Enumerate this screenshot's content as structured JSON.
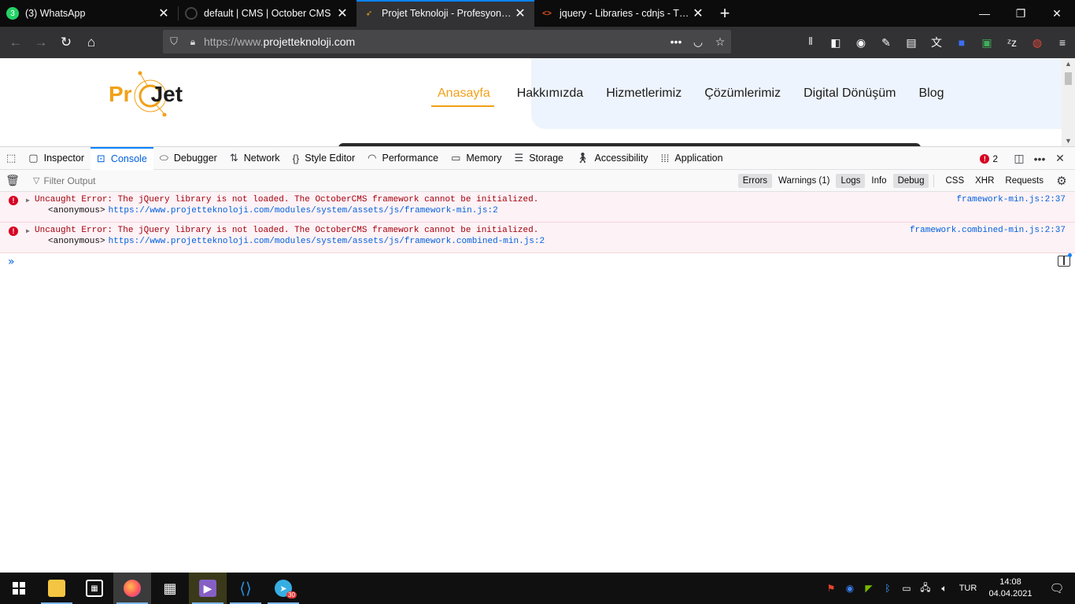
{
  "browser": {
    "tabs": [
      {
        "title": "(3) WhatsApp",
        "badge": "3",
        "favicon": "whatsapp-icon",
        "color": "#25d366"
      },
      {
        "title": "default | CMS | October CMS",
        "favicon": "github-icon",
        "color": "#444444"
      },
      {
        "title": "Projet Teknoloji - Profesyonel, I",
        "favicon": "projet-icon",
        "color": "#f1a017",
        "active": true
      },
      {
        "title": "jquery - Libraries - cdnjs - The #",
        "favicon": "code-icon",
        "color": "#e95420"
      }
    ],
    "url_scheme": "https://www.",
    "url_host": "projetteknoloji.com"
  },
  "website": {
    "logo": {
      "pr": "Pr",
      "o": "O",
      "jet": "Jet"
    },
    "nav": [
      "Anasayfa",
      "Hakkımızda",
      "Hizmetlerimiz",
      "Çözümlerimiz",
      "Digital Dönüşüm",
      "Blog"
    ],
    "nav_active": "Anasayfa"
  },
  "devtools": {
    "tabs": [
      {
        "label": "Inspector",
        "icon": "inspector-icon"
      },
      {
        "label": "Console",
        "icon": "console-icon",
        "active": true
      },
      {
        "label": "Debugger",
        "icon": "debugger-icon"
      },
      {
        "label": "Network",
        "icon": "network-icon"
      },
      {
        "label": "Style Editor",
        "icon": "style-editor-icon"
      },
      {
        "label": "Performance",
        "icon": "performance-icon"
      },
      {
        "label": "Memory",
        "icon": "memory-icon"
      },
      {
        "label": "Storage",
        "icon": "storage-icon"
      },
      {
        "label": "Accessibility",
        "icon": "accessibility-icon"
      },
      {
        "label": "Application",
        "icon": "application-icon"
      }
    ],
    "error_count": "2",
    "filter_placeholder": "Filter Output",
    "filters": [
      {
        "label": "Errors",
        "on": true
      },
      {
        "label": "Warnings (1)",
        "on": false
      },
      {
        "label": "Logs",
        "on": true
      },
      {
        "label": "Info",
        "on": false
      },
      {
        "label": "Debug",
        "on": true
      }
    ],
    "net_filters": [
      "CSS",
      "XHR",
      "Requests"
    ],
    "messages": [
      {
        "text": "Uncaught Error: The jQuery library is not loaded. The OctoberCMS framework cannot be initialized.",
        "frame_fn": "<anonymous>",
        "frame_url": "https://www.projetteknoloji.com/modules/system/assets/js/framework-min.js:2",
        "source": "framework-min.js:2:37"
      },
      {
        "text": "Uncaught Error: The jQuery library is not loaded. The OctoberCMS framework cannot be initialized.",
        "frame_fn": "<anonymous>",
        "frame_url": "https://www.projetteknoloji.com/modules/system/assets/js/framework.combined-min.js:2",
        "source": "framework.combined-min.js:2:37"
      }
    ]
  },
  "taskbar": {
    "apps": [
      {
        "name": "file-explorer-icon",
        "glyph": "▆",
        "color": "#f4c542"
      },
      {
        "name": "store-icon",
        "glyph": "🛍",
        "color": "#ffffff"
      },
      {
        "name": "firefox-icon",
        "glyph": "●",
        "color": "#ff7139",
        "active": true
      },
      {
        "name": "calculator-icon",
        "glyph": "▦",
        "color": "#ffffff"
      },
      {
        "name": "visual-studio-icon",
        "glyph": "◣",
        "color": "#865fc5"
      },
      {
        "name": "vscode-icon",
        "glyph": "◆",
        "color": "#2c8fdd"
      },
      {
        "name": "telegram-icon",
        "glyph": "➤",
        "color": "#37aee2",
        "badge": "30"
      }
    ],
    "lang": "TUR",
    "time": "14:08",
    "date": "04.04.2021"
  }
}
